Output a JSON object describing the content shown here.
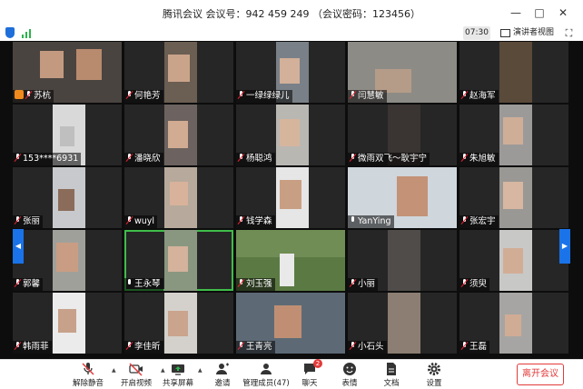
{
  "window": {
    "title": "腾讯会议  会议号：942 459 249 （会议密码：123456）",
    "controls": [
      "minimize-icon",
      "maximize-icon",
      "close-icon"
    ]
  },
  "infobar": {
    "timer": "07:30",
    "speaker_view_label": "演讲者视图",
    "icons": [
      "shield-icon",
      "signal-icon",
      "speaker-view-icon",
      "fullscreen-icon"
    ]
  },
  "participants": [
    {
      "name": "苏杭",
      "muted": true,
      "host": true
    },
    {
      "name": "何艳芳",
      "muted": true
    },
    {
      "name": "一绿绿绿儿",
      "muted": true
    },
    {
      "name": "闫慧敏",
      "muted": true
    },
    {
      "name": "赵海军",
      "muted": true
    },
    {
      "name": "153****6931",
      "muted": true
    },
    {
      "name": "潘晓欣",
      "muted": true
    },
    {
      "name": "杨聪鸿",
      "muted": true
    },
    {
      "name": "微雨双飞～耿宇宁",
      "muted": true
    },
    {
      "name": "朱旭敏",
      "muted": true
    },
    {
      "name": "张丽",
      "muted": true
    },
    {
      "name": "wuyl",
      "muted": true
    },
    {
      "name": "钱学森",
      "muted": true
    },
    {
      "name": "YanYing",
      "muted": false
    },
    {
      "name": "张宏宇",
      "muted": true
    },
    {
      "name": "郭馨",
      "muted": true
    },
    {
      "name": "王永琴",
      "muted": false,
      "active_speaker": true
    },
    {
      "name": "刘玉强",
      "muted": true
    },
    {
      "name": "小丽",
      "muted": true
    },
    {
      "name": "须臾",
      "muted": true
    },
    {
      "name": "韩雨菲",
      "muted": true
    },
    {
      "name": "李佳昕",
      "muted": true
    },
    {
      "name": "王青亮",
      "muted": true
    },
    {
      "name": "小石头",
      "muted": true
    },
    {
      "name": "王磊",
      "muted": true
    }
  ],
  "pager": {
    "left_icon": "chevron-left-icon",
    "right_icon": "chevron-right-icon"
  },
  "toolbar": {
    "unmute": "解除静音",
    "start_video": "开启视频",
    "share_screen": "共享屏幕",
    "invite": "邀请",
    "manage_members": "管理成员(47)",
    "chat": "聊天",
    "chat_badge": "2",
    "reactions": "表情",
    "docs": "文档",
    "settings": "设置",
    "leave": "离开会议"
  },
  "colors": {
    "accent_blue": "#1a73e8",
    "leave_red": "#e23a3a",
    "speaking_green": "#3fbd4a",
    "host_orange": "#f08a1c"
  }
}
